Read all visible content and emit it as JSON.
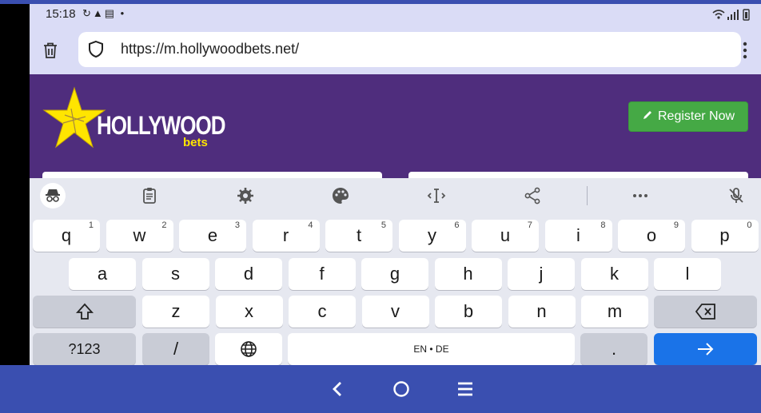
{
  "status": {
    "time": "15:18"
  },
  "browser": {
    "url": "https://m.hollywoodbets.net/"
  },
  "site": {
    "logo_main": "HOLLYWOOD",
    "logo_sub": "bets",
    "register_label": "Register Now",
    "colors": {
      "header": "#4f2d7d",
      "register": "#45a945",
      "logo_yellow": "#ffe500"
    }
  },
  "keyboard": {
    "toolbar_icons": [
      "incognito-icon",
      "clipboard-icon",
      "settings-icon",
      "palette-icon",
      "text-cursor-icon",
      "share-icon",
      "more-icon",
      "mic-off-icon"
    ],
    "row1": [
      {
        "k": "q",
        "n": "1"
      },
      {
        "k": "w",
        "n": "2"
      },
      {
        "k": "e",
        "n": "3"
      },
      {
        "k": "r",
        "n": "4"
      },
      {
        "k": "t",
        "n": "5"
      },
      {
        "k": "y",
        "n": "6"
      },
      {
        "k": "u",
        "n": "7"
      },
      {
        "k": "i",
        "n": "8"
      },
      {
        "k": "o",
        "n": "9"
      },
      {
        "k": "p",
        "n": "0"
      }
    ],
    "row2": [
      "a",
      "s",
      "d",
      "f",
      "g",
      "h",
      "j",
      "k",
      "l"
    ],
    "row3": [
      "z",
      "x",
      "c",
      "v",
      "b",
      "n",
      "m"
    ],
    "sym_label": "?123",
    "slash_label": "/",
    "space_label": "EN • DE",
    "period_label": ".",
    "enter_color": "#1a73e8"
  }
}
